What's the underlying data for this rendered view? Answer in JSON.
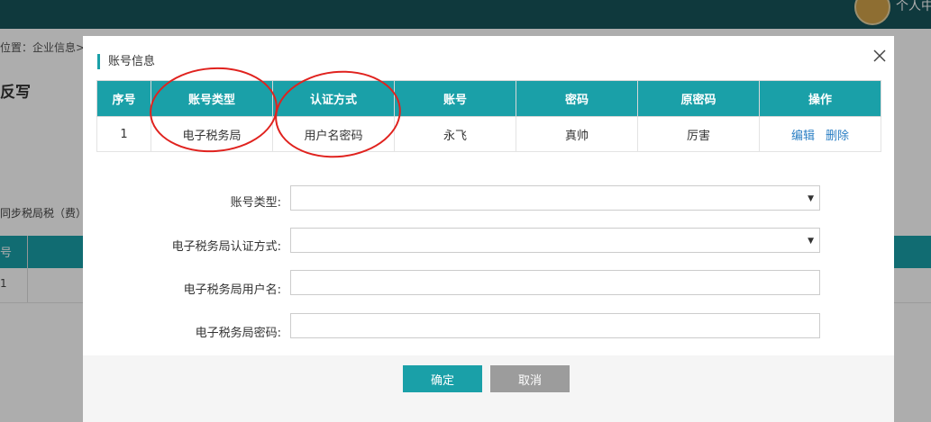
{
  "background": {
    "user_name": "个人中",
    "breadcrumb": "位置：企业信息>",
    "heading": "反写",
    "toolbar_text": "同步税局税（费）",
    "table_header": "号",
    "table_cell": "1"
  },
  "modal": {
    "title": "账号信息",
    "table": {
      "headers": [
        "序号",
        "账号类型",
        "认证方式",
        "账号",
        "密码",
        "原密码",
        "操作"
      ],
      "rows": [
        {
          "index": "1",
          "type": "电子税务局",
          "auth": "用户名密码",
          "account": "永飞",
          "password": "真帅",
          "old_password": "厉害",
          "edit": "编辑",
          "delete": "删除"
        }
      ]
    },
    "form": {
      "account_type_label": "账号类型:",
      "auth_method_label": "电子税务局认证方式:",
      "username_label": "电子税务局用户名:",
      "password_label": "电子税务局密码:",
      "account_type_value": "",
      "auth_method_value": "",
      "username_value": "",
      "password_value": ""
    },
    "buttons": {
      "ok": "确定",
      "cancel": "取消"
    }
  },
  "colors": {
    "accent": "#1aa0a8",
    "topbar": "#17545a",
    "annotation": "#e0221e",
    "cancel": "#9c9c9c",
    "link": "#2b7fc4"
  },
  "icons": {
    "close": "close-icon",
    "select_caret": "caret-down-icon"
  }
}
